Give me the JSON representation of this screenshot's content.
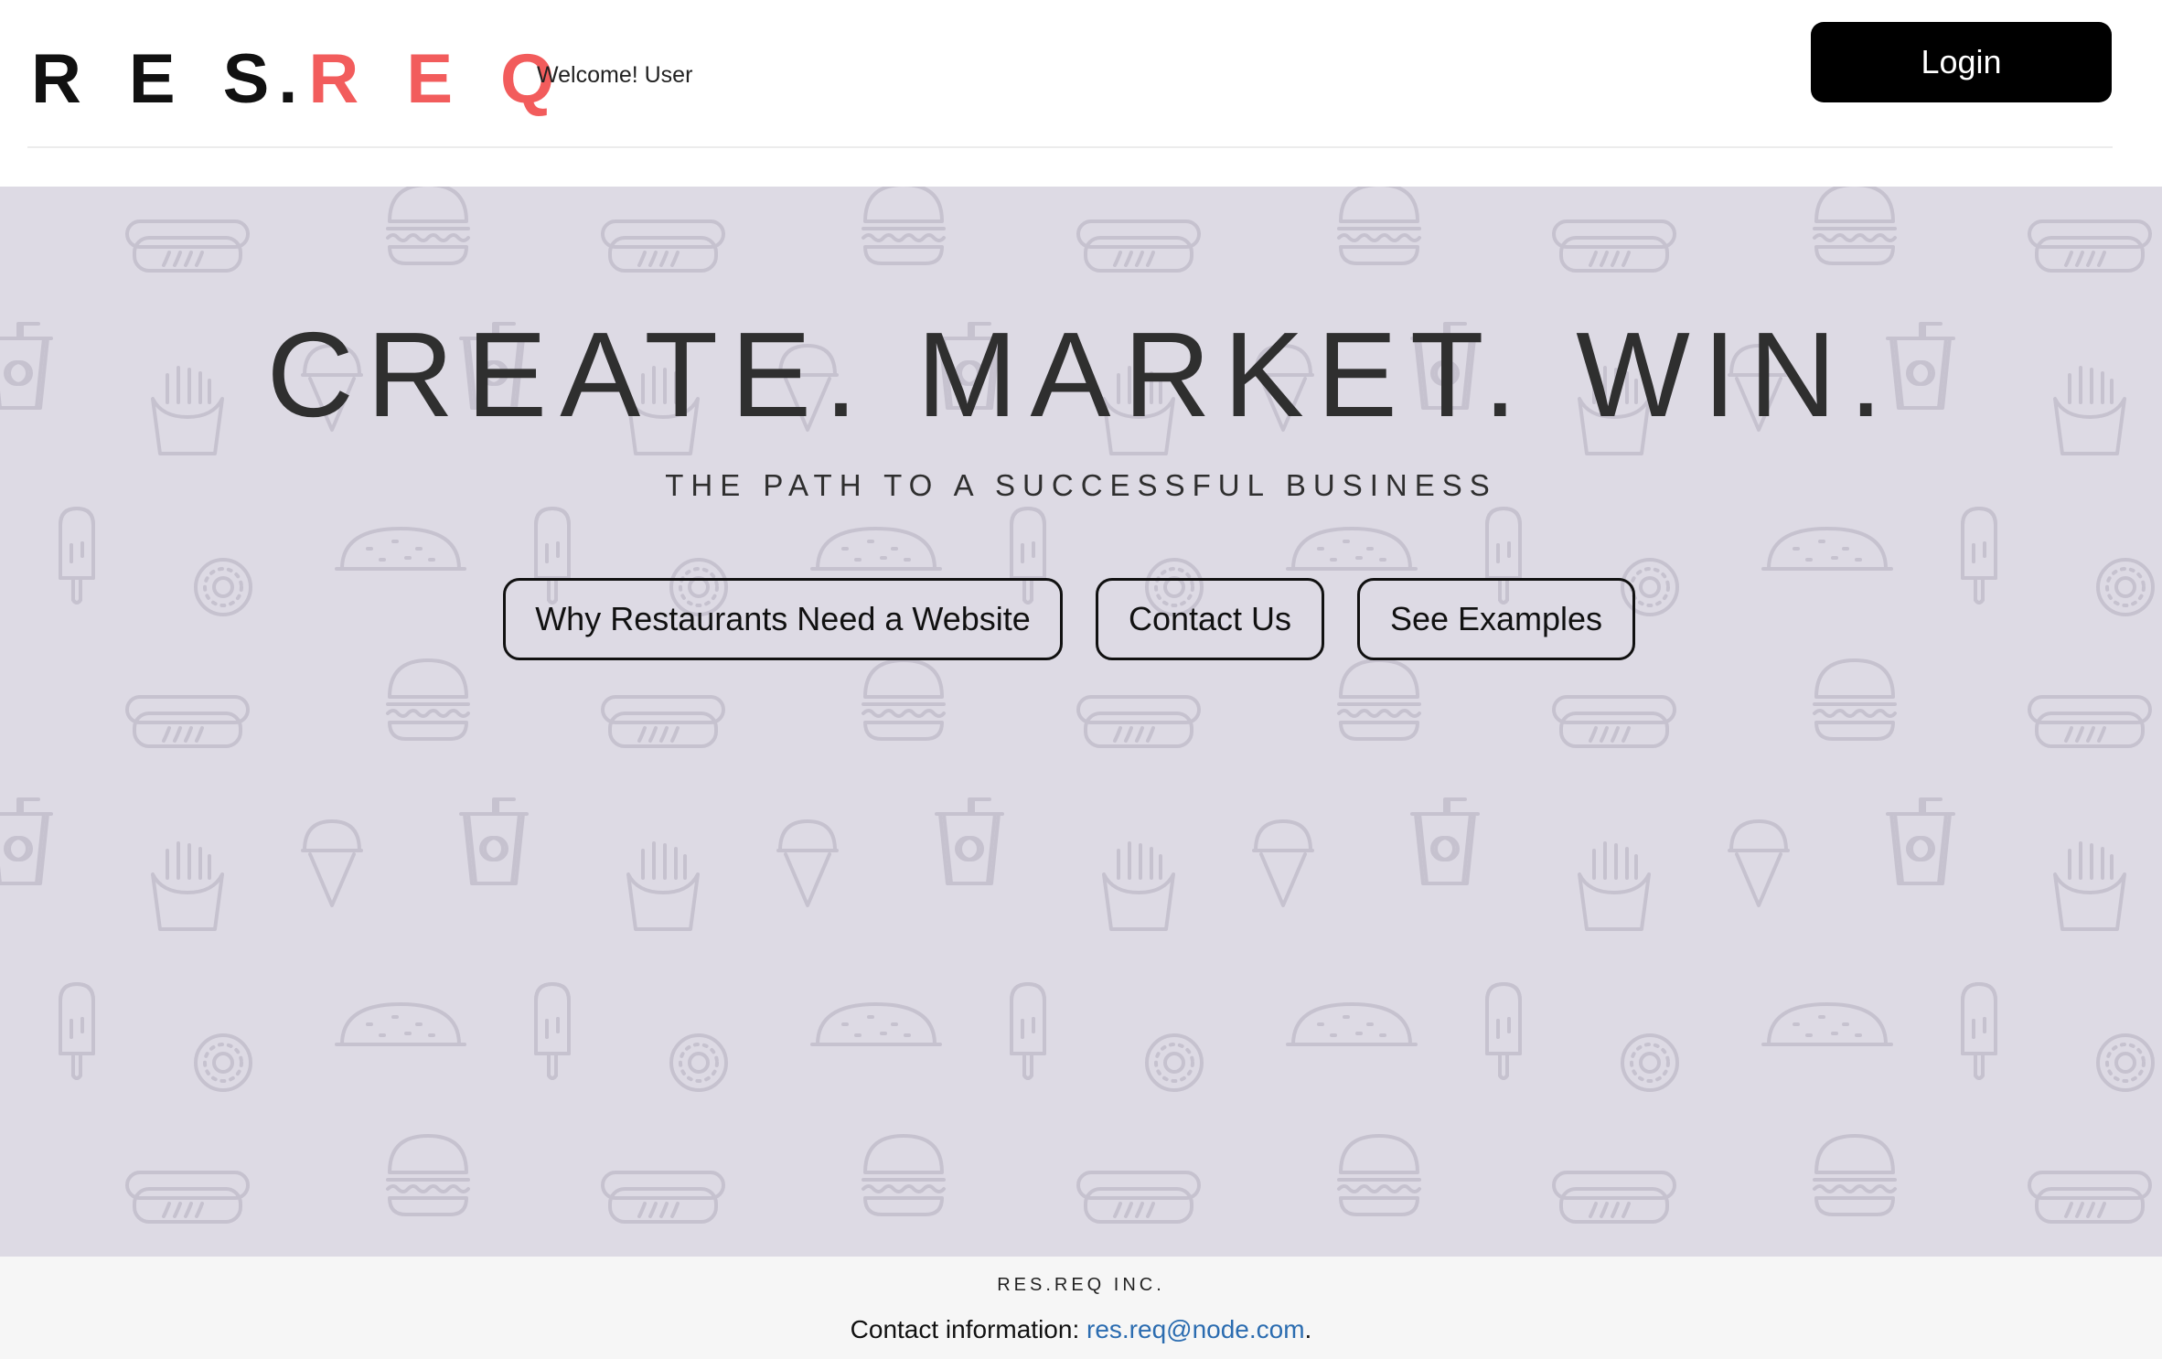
{
  "header": {
    "brand": {
      "letters_dark": [
        "R",
        "E",
        "S",
        "."
      ],
      "letters_red": [
        "R",
        "E",
        "Q"
      ],
      "dark_color": "#111111",
      "red_color": "#f25c5c"
    },
    "welcome_text": "Welcome! User",
    "login_label": "Login"
  },
  "hero": {
    "background_color": "#dddae4",
    "pattern_icon_names": [
      "hotdog-icon",
      "burger-icon",
      "soda-cup-icon",
      "fries-icon",
      "ice-cream-cone-icon",
      "popsicle-icon",
      "donut-icon",
      "taco-icon"
    ],
    "title": "CREATE. MARKET. WIN.",
    "subtitle": "THE PATH TO A SUCCESSFUL BUSINESS",
    "buttons": [
      {
        "label": "Why Restaurants Need a Website"
      },
      {
        "label": "Contact Us"
      },
      {
        "label": "See Examples"
      }
    ]
  },
  "footer": {
    "company": "RES.REQ INC.",
    "contact_prefix": "Contact information: ",
    "contact_email": "res.req@node.com",
    "contact_suffix": ".",
    "link_color": "#2b6cb0"
  }
}
